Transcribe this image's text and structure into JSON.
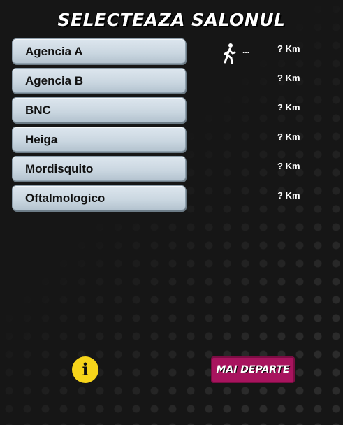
{
  "header": {
    "title": "SELECTEAZA SALONUL"
  },
  "salons": [
    {
      "name": "Agencia A",
      "distance": "? Km"
    },
    {
      "name": "Agencia B",
      "distance": "? Km"
    },
    {
      "name": "BNC",
      "distance": "? Km"
    },
    {
      "name": "Heiga",
      "distance": "? Km"
    },
    {
      "name": "Mordisquito",
      "distance": "? Km"
    },
    {
      "name": "Oftalmologico",
      "distance": "? Km"
    }
  ],
  "location_status": {
    "icon": "walking-person-icon",
    "text": "..."
  },
  "footer": {
    "info_icon": "info-icon",
    "info_glyph": "i",
    "next_label": "MAI DEPARTE"
  },
  "colors": {
    "background": "#161616",
    "button_fill": "#c9d6e0",
    "info_yellow": "#f7d51a",
    "next_magenta": "#a8145e"
  }
}
